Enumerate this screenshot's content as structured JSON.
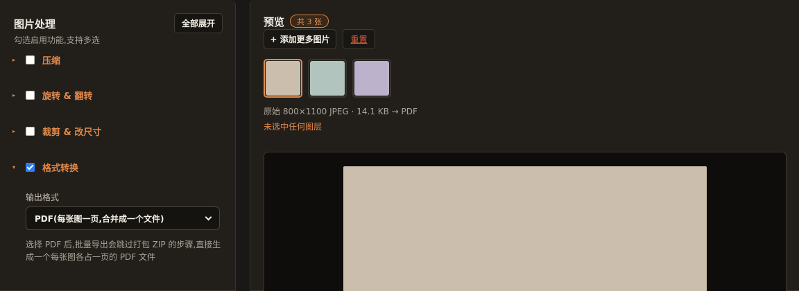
{
  "left": {
    "title": "图片处理",
    "subtitle": "勾选启用功能,支持多选",
    "expand_all_label": "全部展开",
    "features": [
      {
        "label": "压缩",
        "checked": false,
        "expanded": false
      },
      {
        "label": "旋转 & 翻转",
        "checked": false,
        "expanded": false
      },
      {
        "label": "裁剪 & 改尺寸",
        "checked": false,
        "expanded": false
      },
      {
        "label": "格式转换",
        "checked": true,
        "expanded": true
      }
    ],
    "format": {
      "label": "输出格式",
      "selected": "PDF(每张图一页,合并成一个文件)",
      "note": "选择 PDF 后,批量导出会跳过打包 ZIP 的步骤,直接生成一个每张图各占一页的 PDF 文件"
    }
  },
  "right": {
    "title": "预览",
    "count_badge": "共 3 张",
    "add_more_label": "+ 添加更多图片",
    "reset_label": "重置",
    "thumbnails": [
      {
        "color": "#cbbeac",
        "selected": true
      },
      {
        "color": "#b1c4bd",
        "selected": false
      },
      {
        "color": "#bcb2cb",
        "selected": false
      }
    ],
    "file_info": "原始 800×1100 JPEG · 14.1 KB → PDF",
    "layer_status": "未选中任何图层",
    "preview_color": "#cbbeac"
  },
  "colors": {
    "accent": "#e2894a",
    "background": "#1a1816",
    "panel": "#221f1b",
    "danger": "#e06040"
  }
}
